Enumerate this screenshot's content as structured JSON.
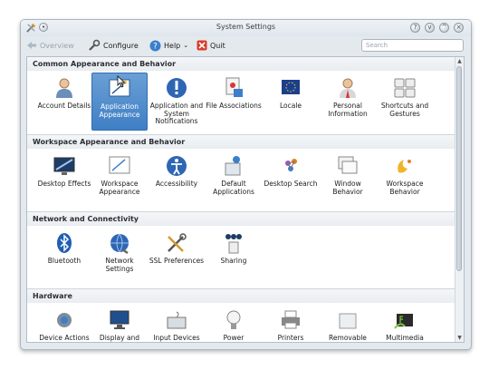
{
  "window": {
    "title": "System Settings"
  },
  "toolbar": {
    "overview_label": "Overview",
    "configure_label": "Configure",
    "help_label": "Help",
    "quit_label": "Quit",
    "search_placeholder": "Search"
  },
  "groups": [
    {
      "title": "Common Appearance and Behavior",
      "items": [
        {
          "label": "Account Details",
          "icon": "user-icon"
        },
        {
          "label": "Application Appearance",
          "icon": "appearance-icon",
          "selected": true
        },
        {
          "label": "Application and System Notifications",
          "icon": "notification-icon"
        },
        {
          "label": "File Associations",
          "icon": "file-associations-icon"
        },
        {
          "label": "Locale",
          "icon": "locale-icon"
        },
        {
          "label": "Personal Information",
          "icon": "personal-info-icon"
        },
        {
          "label": "Shortcuts and Gestures",
          "icon": "shortcuts-icon"
        }
      ]
    },
    {
      "title": "Workspace Appearance and Behavior",
      "items": [
        {
          "label": "Desktop Effects",
          "icon": "desktop-effects-icon"
        },
        {
          "label": "Workspace Appearance",
          "icon": "workspace-appearance-icon"
        },
        {
          "label": "Accessibility",
          "icon": "accessibility-icon"
        },
        {
          "label": "Default Applications",
          "icon": "default-apps-icon"
        },
        {
          "label": "Desktop Search",
          "icon": "desktop-search-icon"
        },
        {
          "label": "Window Behavior",
          "icon": "window-behavior-icon"
        },
        {
          "label": "Workspace Behavior",
          "icon": "workspace-behavior-icon"
        }
      ]
    },
    {
      "title": "Network and Connectivity",
      "items": [
        {
          "label": "Bluetooth",
          "icon": "bluetooth-icon"
        },
        {
          "label": "Network Settings",
          "icon": "network-icon"
        },
        {
          "label": "SSL Preferences",
          "icon": "ssl-icon"
        },
        {
          "label": "Sharing",
          "icon": "sharing-icon"
        }
      ]
    },
    {
      "title": "Hardware",
      "items": [
        {
          "label": "Device Actions",
          "icon": "device-actions-icon"
        },
        {
          "label": "Display and Monitor",
          "icon": "display-icon"
        },
        {
          "label": "Input Devices",
          "icon": "input-devices-icon"
        },
        {
          "label": "Power Management",
          "icon": "power-icon"
        },
        {
          "label": "Printers",
          "icon": "printer-icon"
        },
        {
          "label": "Removable Devices",
          "icon": "removable-icon"
        },
        {
          "label": "Multimedia",
          "icon": "multimedia-icon"
        }
      ]
    }
  ],
  "colors": {
    "selection": "#3f7fc4",
    "accent": "#2f6eb3"
  }
}
